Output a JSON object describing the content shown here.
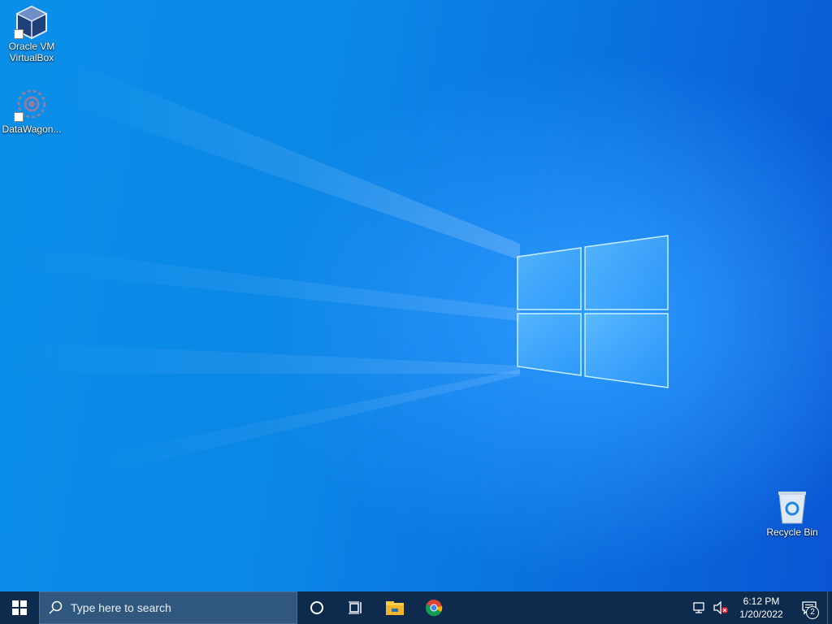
{
  "desktop": {
    "icons": [
      {
        "label": "Oracle VM VirtualBox",
        "label_lines": [
          "Oracle VM",
          "VirtualBox"
        ],
        "icon": "virtualbox-icon"
      },
      {
        "label": "DataWagon...",
        "icon": "datawagon-icon"
      },
      {
        "label": "Recycle Bin",
        "icon": "recycle-bin-icon"
      }
    ]
  },
  "taskbar": {
    "search_placeholder": "Type here to search",
    "pinned": [
      "cortana-icon",
      "task-view-icon",
      "file-explorer-icon",
      "chrome-icon"
    ],
    "tray": {
      "time": "6:12 PM",
      "date": "1/20/2022",
      "notification_count": "2"
    }
  },
  "colors": {
    "taskbar": "#0e2a4d",
    "search_box": "#30577e",
    "wallpaper_accent": "#0a8fe8"
  }
}
